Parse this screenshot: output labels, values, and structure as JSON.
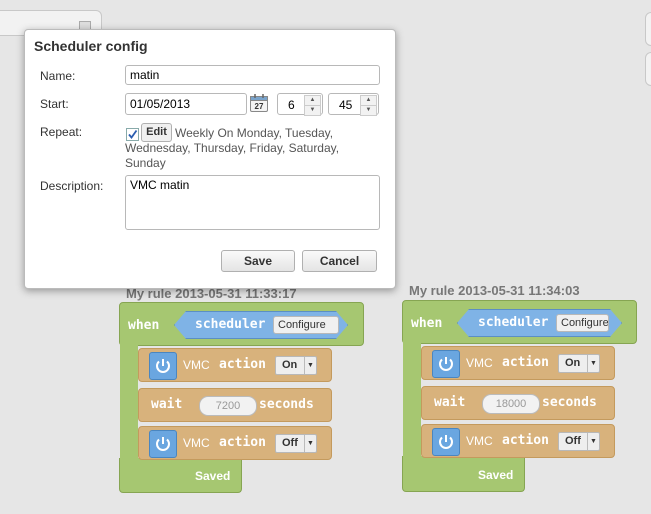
{
  "dialog": {
    "title": "Scheduler config",
    "name_label": "Name:",
    "name_value": "matin",
    "start_label": "Start:",
    "start_date": "01/05/2013",
    "calendar_day": "27",
    "start_hour": "6",
    "start_minute": "45",
    "repeat_label": "Repeat:",
    "repeat_checked": true,
    "edit_label": "Edit",
    "repeat_text": "Weekly On Monday, Tuesday, Wednesday, Thursday, Friday, Saturday, Sunday",
    "description_label": "Description:",
    "description_value": "VMC matin",
    "save_label": "Save",
    "cancel_label": "Cancel"
  },
  "rules": [
    {
      "title": "My rule 2013-05-31 11:33:17",
      "when": "when",
      "event": "scheduler",
      "configure": "Configure",
      "action1": {
        "device": "VMC",
        "keyword": "action",
        "value": "On"
      },
      "wait": {
        "keyword": "wait",
        "value": "7200",
        "unit": "seconds"
      },
      "action2": {
        "device": "VMC",
        "keyword": "action",
        "value": "Off"
      },
      "status": "Saved"
    },
    {
      "title": "My rule 2013-05-31 11:34:03",
      "when": "when",
      "event": "scheduler",
      "configure": "Configure",
      "action1": {
        "device": "VMC",
        "keyword": "action",
        "value": "On"
      },
      "wait": {
        "keyword": "wait",
        "value": "18000",
        "unit": "seconds"
      },
      "action2": {
        "device": "VMC",
        "keyword": "action",
        "value": "Off"
      },
      "status": "Saved"
    }
  ],
  "colors": {
    "rule_green": "#a6c771",
    "statement_tan": "#d8b27c",
    "event_blue": "#7fb3e6",
    "power_blue": "#6aa6e0"
  },
  "icons": [
    "calendar-icon",
    "power-icon",
    "checkmark-icon",
    "dropdown-arrow-icon",
    "spinner-up-icon",
    "spinner-down-icon"
  ]
}
